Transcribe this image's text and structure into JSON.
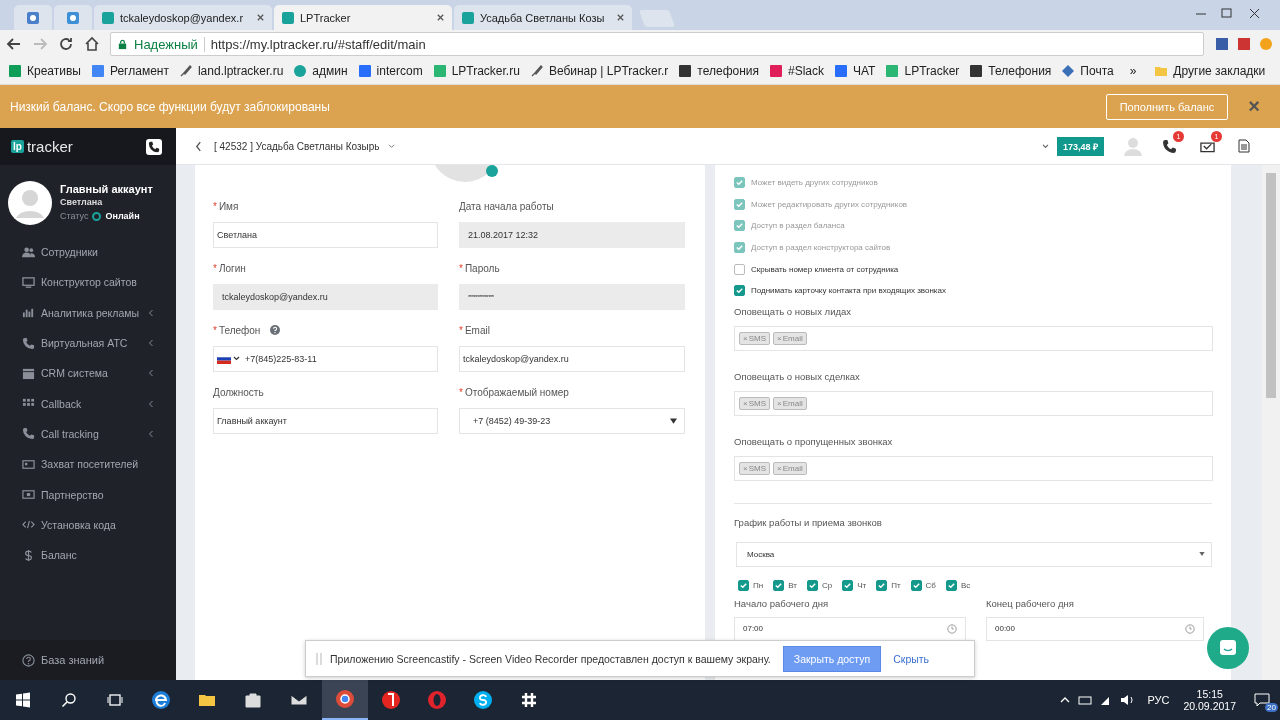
{
  "browser": {
    "tabs": [
      {
        "kind": "pinned",
        "selected": false
      },
      {
        "kind": "pinned",
        "selected": false
      },
      {
        "kind": "page",
        "title": "tckaleydoskop@yandex.r",
        "selected": false
      },
      {
        "kind": "page",
        "title": "LPTracker",
        "selected": true
      },
      {
        "kind": "page",
        "title": "Усадьба Светланы Козы",
        "selected": false
      }
    ],
    "security_label": "Надежный",
    "url": "https://my.lptracker.ru/#staff/edit/main",
    "bookmarks": [
      {
        "kind": "sheet",
        "label": "Креативы"
      },
      {
        "kind": "doc",
        "label": "Регламент"
      },
      {
        "kind": "rocket",
        "label": "land.lptracker.ru"
      },
      {
        "kind": "clock",
        "label": "админ"
      },
      {
        "kind": "chat",
        "label": "intercom"
      },
      {
        "kind": "lp",
        "label": "LPTracker.ru"
      },
      {
        "kind": "rocket",
        "label": "Вебинар | LPTracker.r"
      },
      {
        "kind": "t",
        "label": "телефония"
      },
      {
        "kind": "hash",
        "label": "#Slack"
      },
      {
        "kind": "chat",
        "label": "ЧАТ"
      },
      {
        "kind": "lp",
        "label": "LPTracker"
      },
      {
        "kind": "t",
        "label": "Телефония"
      },
      {
        "kind": "mail",
        "label": "Почта"
      }
    ],
    "bookmarks_more": "»",
    "other_bookmarks": "Другие закладки"
  },
  "banner": {
    "message": "Низкий баланс. Скоро все функции будут заблокированы",
    "button": "Пополнить баланс",
    "close": "×"
  },
  "sidebar": {
    "logo_badge": "lp",
    "logo_text": "tracker",
    "profile": {
      "name": "Главный аккаунт",
      "login": "Светлана",
      "status_label": "Статус",
      "status": "Онлайн",
      "online": true
    },
    "items": [
      {
        "kind": "users",
        "label": "Сотрудники",
        "has_submenu": false
      },
      {
        "kind": "monitor",
        "label": "Конструктор сайтов",
        "has_submenu": false
      },
      {
        "kind": "chart",
        "label": "Аналитика рекламы",
        "has_submenu": true
      },
      {
        "kind": "phone",
        "label": "Виртуальная АТС",
        "has_submenu": true
      },
      {
        "kind": "calendar",
        "label": "CRM система",
        "has_submenu": true
      },
      {
        "kind": "grid",
        "label": "Callback",
        "has_submenu": true
      },
      {
        "kind": "phone",
        "label": "Call tracking",
        "has_submenu": true
      },
      {
        "kind": "card",
        "label": "Захват посетителей",
        "has_submenu": false
      },
      {
        "kind": "money",
        "label": "Партнерство",
        "has_submenu": false
      },
      {
        "kind": "code",
        "label": "Установка кода",
        "has_submenu": false
      },
      {
        "kind": "dollar",
        "label": "Баланс",
        "has_submenu": false
      }
    ],
    "footer": "База знаний"
  },
  "header": {
    "title": "[ 42532 ] Усадьба Светланы Козырь",
    "balance": "173,48 ₽",
    "calls_badge": "1",
    "tasks_badge": "1"
  },
  "fields": [
    {
      "label": "Имя",
      "required": "*",
      "kind": "text",
      "value": "Светлана",
      "disabled": false
    },
    {
      "label": "Дата начала работы",
      "kind": "text",
      "value": "21.08.2017 12:32",
      "disabled": true
    },
    {
      "label": "Логин",
      "required": "*",
      "kind": "text",
      "value": "tckaleydoskop@yandex.ru",
      "disabled": true
    },
    {
      "label": "Пароль",
      "required": "*",
      "kind": "text",
      "value": "**************",
      "disabled": true
    },
    {
      "label": "Телефон",
      "required": "*",
      "help": true,
      "kind": "phone",
      "value": "+7(845)225-83-11",
      "disabled": false
    },
    {
      "label": "Email",
      "required": "*",
      "kind": "text",
      "value": "tckaleydoskop@yandex.ru",
      "disabled": false
    },
    {
      "label": "Должность",
      "kind": "text",
      "value": "Главный аккаунт",
      "disabled": false
    },
    {
      "label": "Отображаемый номер",
      "required": "*",
      "kind": "select",
      "value": "+7 (8452) 49-39-23",
      "disabled": false
    }
  ],
  "permissions": [
    {
      "label": "Может видеть других сотрудников",
      "checked": true,
      "disabled": true
    },
    {
      "label": "Может редактировать других сотрудников",
      "checked": true,
      "disabled": true
    },
    {
      "label": "Доступ в раздел баланса",
      "checked": true,
      "disabled": true
    },
    {
      "label": "Доступ в раздел конструктора сайтов",
      "checked": true,
      "disabled": true
    },
    {
      "label": "Скрывать номер клиента от сотрудника",
      "checked": false,
      "disabled": false
    },
    {
      "label": "Поднимать карточку контакта при входящих звонках",
      "checked": true,
      "disabled": false
    }
  ],
  "notify": [
    {
      "label": "Оповещать о новых лидах",
      "tags": [
        {
          "remove": "×",
          "label": "SMS"
        },
        {
          "remove": "×",
          "label": "Email"
        }
      ]
    },
    {
      "label": "Оповещать о новых сделках",
      "tags": [
        {
          "remove": "×",
          "label": "SMS"
        },
        {
          "remove": "×",
          "label": "Email"
        }
      ]
    },
    {
      "label": "Оповещать о пропущенных звонках",
      "tags": [
        {
          "remove": "×",
          "label": "SMS"
        },
        {
          "remove": "×",
          "label": "Email"
        }
      ]
    }
  ],
  "schedule": {
    "title": "График работы и приема звонков",
    "timezone": "Москва",
    "days": [
      {
        "label": "Пн",
        "checked": true
      },
      {
        "label": "Вт",
        "checked": true
      },
      {
        "label": "Ср",
        "checked": true
      },
      {
        "label": "Чт",
        "checked": true
      },
      {
        "label": "Пт",
        "checked": true
      },
      {
        "label": "Сб",
        "checked": true
      },
      {
        "label": "Вс",
        "checked": true
      }
    ],
    "start": {
      "label": "Начало рабочего дня",
      "value": "07:00"
    },
    "end": {
      "label": "Конец рабочего дня",
      "value": "00:00"
    }
  },
  "share_bar": {
    "message": "Приложению Screencastify - Screen Video Recorder предоставлен доступ к вашему экрану.",
    "stop_button": "Закрыть доступ",
    "hide_link": "Скрыть"
  },
  "taskbar": {
    "apps": [
      {
        "kind": "edge",
        "selected": false
      },
      {
        "kind": "folder",
        "selected": false
      },
      {
        "kind": "store",
        "selected": false
      },
      {
        "kind": "mail",
        "selected": false
      },
      {
        "kind": "chrome",
        "selected": true
      },
      {
        "kind": "yandex",
        "selected": false
      },
      {
        "kind": "opera",
        "selected": false
      },
      {
        "kind": "skype",
        "selected": false
      },
      {
        "kind": "slack",
        "selected": false
      }
    ],
    "language": "РУС",
    "time": "15:15",
    "date": "20.09.2017",
    "notifications": "20"
  }
}
